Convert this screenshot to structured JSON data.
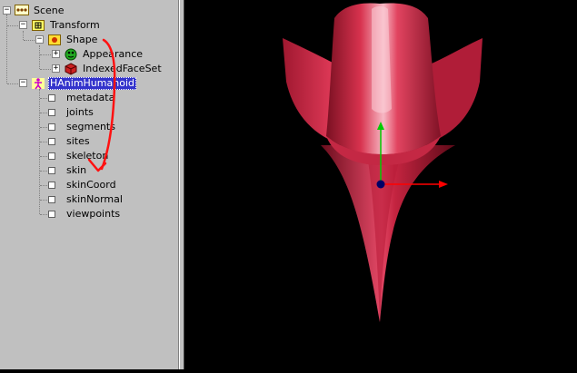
{
  "tree": {
    "scene": "Scene",
    "transform": "Transform",
    "shape": "Shape",
    "appearance": "Appearance",
    "indexed_face_set": "IndexedFaceSet",
    "humanoid": "HAnimHumanoid",
    "fields": [
      "metadata",
      "joints",
      "segments",
      "sites",
      "skeleton",
      "skin",
      "skinCoord",
      "skinNormal",
      "viewpoints"
    ]
  },
  "colors": {
    "panel_bg": "#c0c0c0",
    "selection": "#3333cc",
    "model_fill": "#d8324e",
    "annotation": "#ff0000",
    "axis_y": "#00cc00",
    "axis_x": "#ff0000",
    "axis_origin": "#000066"
  },
  "icons": {
    "scene": "scene-icon",
    "transform": "transform-icon",
    "shape": "shape-icon",
    "appearance": "appearance-icon",
    "indexed_face_set": "indexedfaceset-icon",
    "humanoid": "humanoid-icon",
    "field": "field-icon"
  }
}
